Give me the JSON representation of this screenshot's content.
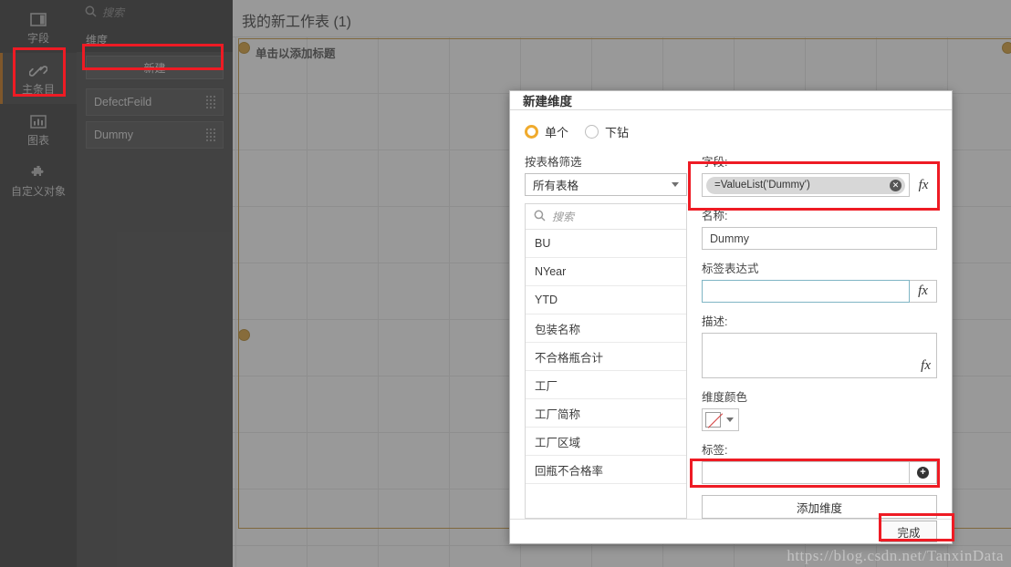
{
  "rail": {
    "items": [
      {
        "label": "字段",
        "icon": "fields-panel-icon",
        "active": false
      },
      {
        "label": "主条目",
        "icon": "link-icon",
        "active": true
      },
      {
        "label": "图表",
        "icon": "chart-icon",
        "active": false
      },
      {
        "label": "自定义对象",
        "icon": "puzzle-icon",
        "active": false
      }
    ]
  },
  "assets": {
    "search_placeholder": "搜索",
    "section_title": "维度",
    "new_button": "新建",
    "items": [
      {
        "label": "DefectFeild"
      },
      {
        "label": "Dummy"
      }
    ]
  },
  "sheet": {
    "title": "我的新工作表 (1)",
    "chart_placeholder": "单击以添加标题"
  },
  "modal": {
    "title": "新建维度",
    "radios": [
      {
        "label": "单个",
        "selected": true
      },
      {
        "label": "下钻",
        "selected": false
      }
    ],
    "filter_label": "按表格筛选",
    "filter_value": "所有表格",
    "field_search_placeholder": "搜索",
    "fields": [
      "BU",
      "NYear",
      "YTD",
      "包装名称",
      "不合格瓶合计",
      "工厂",
      "工厂简称",
      "工厂区域",
      "回瓶不合格率"
    ],
    "field_label": "字段:",
    "field_value": "=ValueList('Dummy')",
    "field_clear_icon": "clear-icon",
    "fx_label": "fx",
    "name_label": "名称:",
    "name_value": "Dummy",
    "label_expr_label": "标签表达式",
    "label_expr_value": "",
    "desc_label": "描述:",
    "desc_value": "",
    "color_label": "维度颜色",
    "color_value": "none",
    "tag_label": "标签:",
    "tag_value": "",
    "add_tag_icon": "plus-icon",
    "add_dimension_button": "添加维度",
    "done_button": "完成"
  },
  "watermark": "https://blog.csdn.net/TanxinData",
  "colors": {
    "accent": "#c8761a",
    "highlight": "#ee1b24",
    "radio_on": "#f0ab2e",
    "frame": "#c8993f"
  }
}
